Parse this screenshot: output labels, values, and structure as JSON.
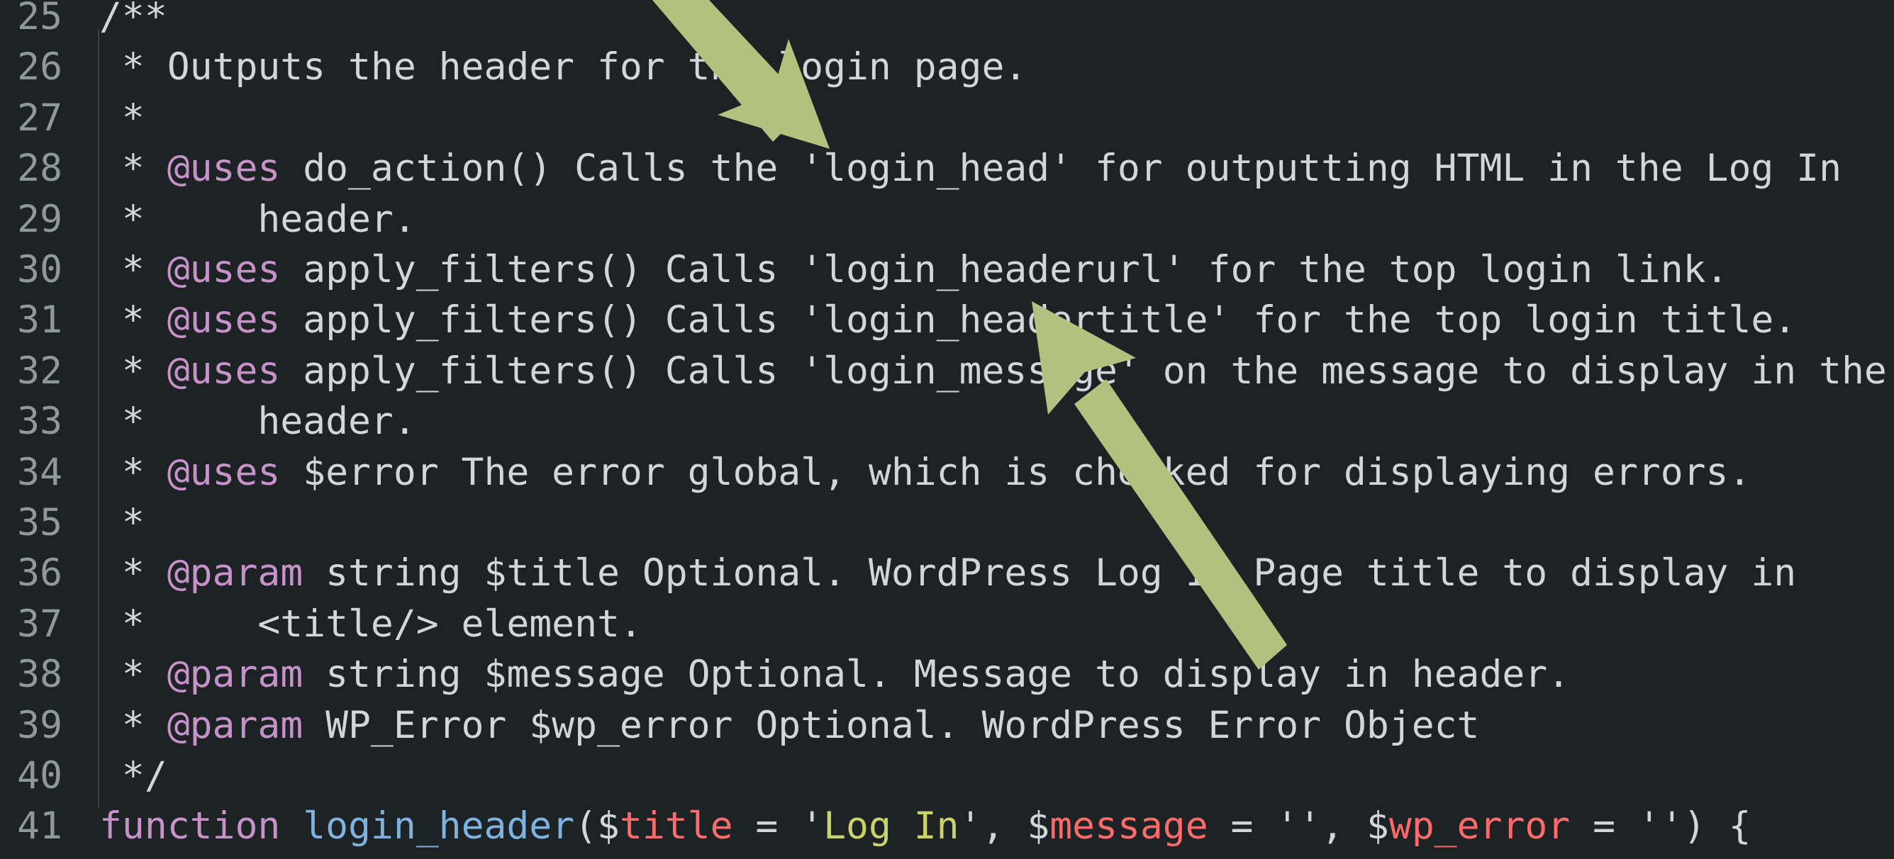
{
  "editor": {
    "lines": [
      {
        "num": "25",
        "segments": [
          {
            "text": "/**",
            "cls": "plain"
          }
        ]
      },
      {
        "num": "26",
        "segments": [
          {
            "text": " * Outputs the header for the login page.",
            "cls": "plain"
          }
        ]
      },
      {
        "num": "27",
        "segments": [
          {
            "text": " *",
            "cls": "plain"
          }
        ]
      },
      {
        "num": "28",
        "segments": [
          {
            "text": " * ",
            "cls": "plain"
          },
          {
            "text": "@uses",
            "cls": "tag"
          },
          {
            "text": " do_action() Calls the 'login_head' for outputting HTML in the Log In",
            "cls": "plain"
          }
        ]
      },
      {
        "num": "29",
        "segments": [
          {
            "text": " *     header.",
            "cls": "plain"
          }
        ]
      },
      {
        "num": "30",
        "segments": [
          {
            "text": " * ",
            "cls": "plain"
          },
          {
            "text": "@uses",
            "cls": "tag"
          },
          {
            "text": " apply_filters() Calls 'login_headerurl' for the top login link.",
            "cls": "plain"
          }
        ]
      },
      {
        "num": "31",
        "segments": [
          {
            "text": " * ",
            "cls": "plain"
          },
          {
            "text": "@uses",
            "cls": "tag"
          },
          {
            "text": " apply_filters() Calls 'login_headertitle' for the top login title.",
            "cls": "plain"
          }
        ]
      },
      {
        "num": "32",
        "segments": [
          {
            "text": " * ",
            "cls": "plain"
          },
          {
            "text": "@uses",
            "cls": "tag"
          },
          {
            "text": " apply_filters() Calls 'login_message' on the message to display in the",
            "cls": "plain"
          }
        ]
      },
      {
        "num": "33",
        "segments": [
          {
            "text": " *     header.",
            "cls": "plain"
          }
        ]
      },
      {
        "num": "34",
        "segments": [
          {
            "text": " * ",
            "cls": "plain"
          },
          {
            "text": "@uses",
            "cls": "tag"
          },
          {
            "text": " $error The error global, which is checked for displaying errors.",
            "cls": "plain"
          }
        ]
      },
      {
        "num": "35",
        "segments": [
          {
            "text": " *",
            "cls": "plain"
          }
        ]
      },
      {
        "num": "36",
        "segments": [
          {
            "text": " * ",
            "cls": "plain"
          },
          {
            "text": "@param",
            "cls": "tag"
          },
          {
            "text": " string $title Optional. WordPress Log In Page title to display in",
            "cls": "plain"
          }
        ]
      },
      {
        "num": "37",
        "segments": [
          {
            "text": " *     <title/> element.",
            "cls": "plain"
          }
        ]
      },
      {
        "num": "38",
        "segments": [
          {
            "text": " * ",
            "cls": "plain"
          },
          {
            "text": "@param",
            "cls": "tag"
          },
          {
            "text": " string $message Optional. Message to display in header.",
            "cls": "plain"
          }
        ]
      },
      {
        "num": "39",
        "segments": [
          {
            "text": " * ",
            "cls": "plain"
          },
          {
            "text": "@param",
            "cls": "tag"
          },
          {
            "text": " WP_Error $wp_error Optional. WordPress Error Object",
            "cls": "plain"
          }
        ]
      },
      {
        "num": "40",
        "segments": [
          {
            "text": " */",
            "cls": "plain"
          }
        ]
      },
      {
        "num": "41",
        "segments": [
          {
            "text": "function",
            "cls": "kw"
          },
          {
            "text": " ",
            "cls": "plain"
          },
          {
            "text": "login_header",
            "cls": "fn"
          },
          {
            "text": "(",
            "cls": "plain"
          },
          {
            "text": "$",
            "cls": "plain"
          },
          {
            "text": "title",
            "cls": "var"
          },
          {
            "text": " = '",
            "cls": "plain"
          },
          {
            "text": "Log In",
            "cls": "str"
          },
          {
            "text": "', ",
            "cls": "plain"
          },
          {
            "text": "$",
            "cls": "plain"
          },
          {
            "text": "message",
            "cls": "var"
          },
          {
            "text": " = '', ",
            "cls": "plain"
          },
          {
            "text": "$",
            "cls": "plain"
          },
          {
            "text": "wp_error",
            "cls": "var"
          },
          {
            "text": " = '') {",
            "cls": "plain"
          }
        ]
      }
    ]
  },
  "annotations": {
    "arrow_color": "#afc27e",
    "arrows": [
      "arrow-pointing-to-line-26",
      "arrow-pointing-to-line-31"
    ]
  }
}
